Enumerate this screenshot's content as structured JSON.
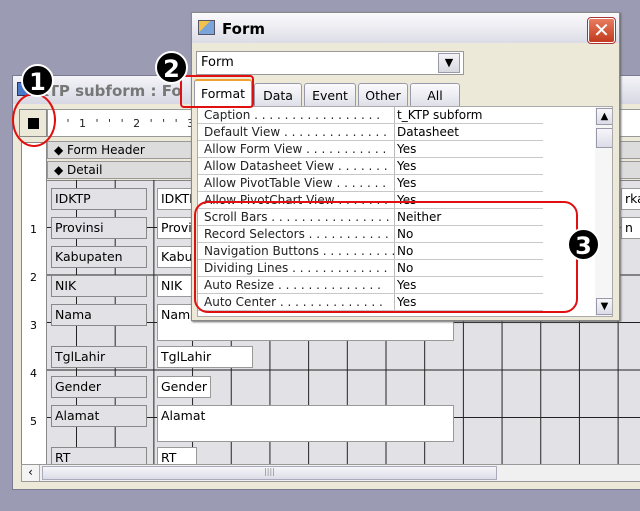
{
  "design_window": {
    "title": "KTP subform : Fo",
    "ruler_marks": "' ' 1 ' ' ' 2 ' ' ' 3",
    "vruler_labels": [
      "1",
      "2",
      "3",
      "4",
      "5"
    ],
    "sections": {
      "form_header": "Form Header",
      "detail": "Detail"
    },
    "controls": [
      {
        "label": "IDKTP",
        "field": "IDKTP"
      },
      {
        "label": "Provinsi",
        "field": "Provinsi"
      },
      {
        "label": "Kabupaten",
        "field": "Kabupaten"
      },
      {
        "label": "NIK",
        "field": "NIK"
      },
      {
        "label": "Nama",
        "field": "Nama"
      },
      {
        "label": "TglLahir",
        "field": "TglLahir"
      },
      {
        "label": "Gender",
        "field": "Gender"
      },
      {
        "label": "Alamat",
        "field": "Alamat"
      },
      {
        "label": "RT",
        "field": "RT"
      }
    ],
    "right_partial": [
      "rkaw",
      "n"
    ]
  },
  "property_sheet": {
    "title": "Form",
    "close_glyph": "✕",
    "object_selector": "Form",
    "tabs": [
      "Format",
      "Data",
      "Event",
      "Other",
      "All"
    ],
    "active_tab": "Format",
    "properties": [
      {
        "name": "Caption . . . . . . . . . . . . . . . . .",
        "value": "t_KTP subform"
      },
      {
        "name": "Default View . . . . . . . . . . . . . .",
        "value": "Datasheet"
      },
      {
        "name": "Allow Form View . . . . . . . . . . .",
        "value": "Yes"
      },
      {
        "name": "Allow Datasheet View . . . . . . .",
        "value": "Yes"
      },
      {
        "name": "Allow PivotTable View . . . . . . .",
        "value": "Yes"
      },
      {
        "name": "Allow PivotChart View . . . . . . .",
        "value": "Yes"
      },
      {
        "name": "Scroll Bars . . . . . . . . . . . . . . . .",
        "value": "Neither"
      },
      {
        "name": "Record Selectors . . . . . . . . . . .",
        "value": "No"
      },
      {
        "name": "Navigation Buttons . . . . . . . . . .",
        "value": "No"
      },
      {
        "name": "Dividing Lines . . . . . . . . . . . . .",
        "value": "No"
      },
      {
        "name": "Auto Resize . . . . . . . . . . . . . .",
        "value": "Yes"
      },
      {
        "name": "Auto Center . . . . . . . . . . . . . .",
        "value": "Yes"
      }
    ]
  },
  "callouts": [
    "1",
    "2",
    "3"
  ],
  "colors": {
    "callout_outline": "#e01010",
    "active_tab_accent": "#f0a030"
  }
}
